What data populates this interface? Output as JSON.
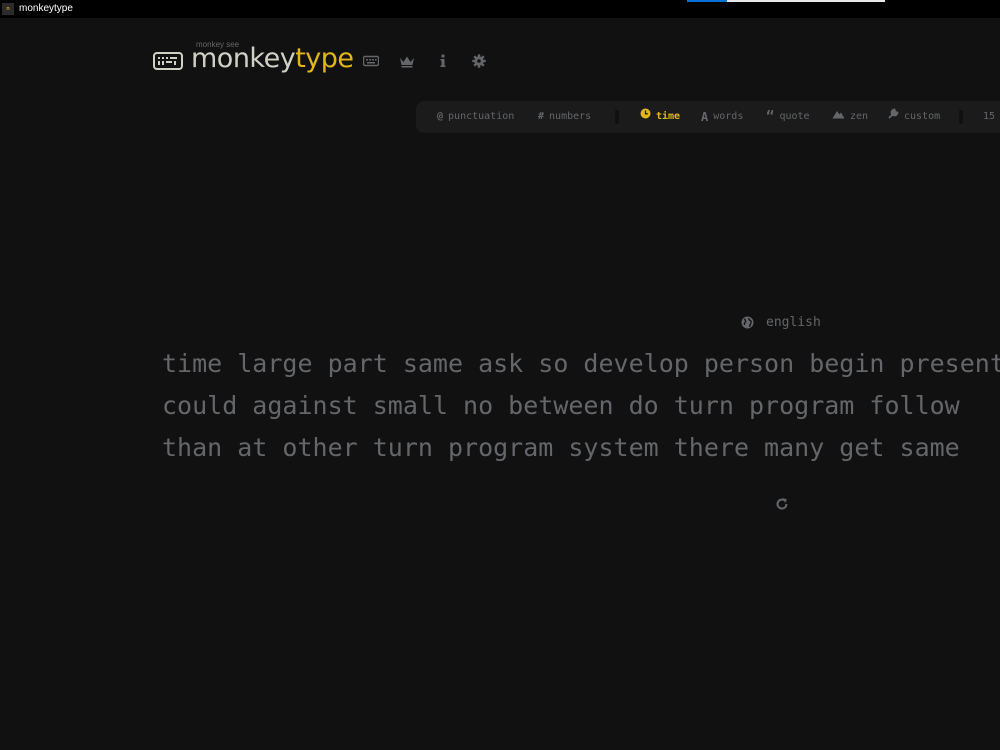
{
  "window": {
    "title": "monkeytype",
    "icon_text": "m"
  },
  "header": {
    "logo_top": "monkey see",
    "logo_main": "monkey",
    "logo_accent": "type",
    "nav_icons": [
      "keyboard-icon",
      "crown-icon",
      "info-icon",
      "gear-icon"
    ]
  },
  "config": {
    "punctuation": "punctuation",
    "numbers": "numbers",
    "time": "time",
    "words": "words",
    "quote": "quote",
    "zen": "zen",
    "custom": "custom",
    "duration": "15"
  },
  "test": {
    "language": "english",
    "lines": [
      "time large part same ask so develop person begin present",
      "could against small no between do turn program follow",
      "than at other turn program system there many get same"
    ]
  },
  "colors": {
    "background": "#111111",
    "accent": "#e2b714",
    "sub": "#646669",
    "text": "#d1d0c5"
  }
}
